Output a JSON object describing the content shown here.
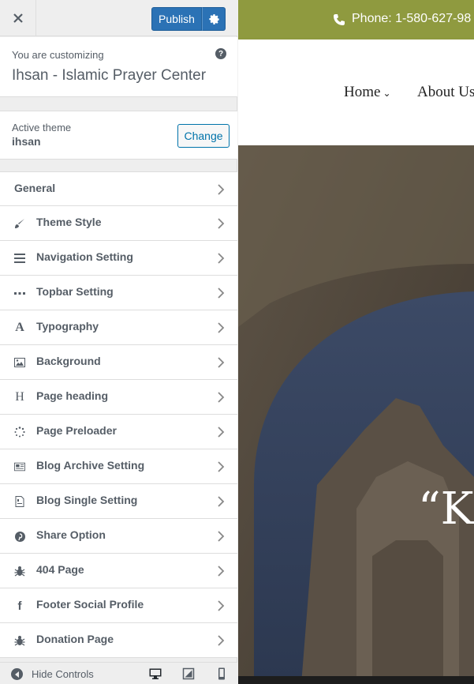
{
  "header": {
    "publish_label": "Publish"
  },
  "info": {
    "pre": "You are customizing",
    "site_title": "Ihsan - Islamic Prayer Center"
  },
  "theme": {
    "label": "Active theme",
    "name": "ihsan",
    "change_label": "Change"
  },
  "sections": [
    {
      "label": "General",
      "icon": "none"
    },
    {
      "label": "Theme Style",
      "icon": "paintbrush-icon"
    },
    {
      "label": "Navigation Setting",
      "icon": "menu-icon"
    },
    {
      "label": "Topbar Setting",
      "icon": "ellipsis-icon"
    },
    {
      "label": "Typography",
      "icon": "typography-icon"
    },
    {
      "label": "Background",
      "icon": "image-icon"
    },
    {
      "label": "Page heading",
      "icon": "heading-icon"
    },
    {
      "label": "Page Preloader",
      "icon": "spinner-icon"
    },
    {
      "label": "Blog Archive Setting",
      "icon": "newspaper-icon"
    },
    {
      "label": "Blog Single Setting",
      "icon": "document-icon"
    },
    {
      "label": "Share Option",
      "icon": "pinterest-icon"
    },
    {
      "label": "404 Page",
      "icon": "bug-icon"
    },
    {
      "label": "Footer Social Profile",
      "icon": "facebook-icon"
    },
    {
      "label": "Donation Page",
      "icon": "bug-icon"
    }
  ],
  "footer": {
    "hide_label": "Hide Controls"
  },
  "preview": {
    "phone": "Phone: 1-580-627-98",
    "nav_home": "Home",
    "nav_about": "About Us",
    "hero_text": "“K"
  },
  "colors": {
    "accent": "#2b72b5",
    "topbar": "#8f9a3f",
    "link": "#0073aa"
  }
}
